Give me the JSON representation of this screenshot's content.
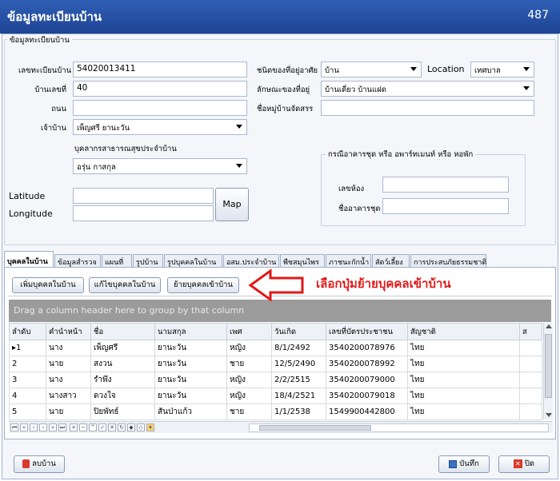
{
  "window": {
    "title": "ข้อมูลทะเบียนบ้าน",
    "record_id": "487"
  },
  "group_title": "ข้อมูลทะเบียนบ้าน",
  "form": {
    "house_reg_label": "เลขทะเบียนบ้าน",
    "house_reg_value": "54020013411",
    "house_no_label": "บ้านเลขที่",
    "house_no_value": "40",
    "road_label": "ถนน",
    "road_value": "",
    "owner_label": "เจ้าบ้าน",
    "owner_value": "เพ็ญศรี ยานะวัน",
    "health_staff_label": "บุคลากรสาธารณสุขประจำบ้าน",
    "health_staff_value": "อรุ่น กาสกุล",
    "latitude_label": "Latitude",
    "latitude_value": "",
    "longitude_label": "Longitude",
    "longitude_value": "",
    "map_button": "Map",
    "residence_type_label": "ชนิดของที่อยู่อาศัย",
    "residence_type_value": "บ้าน",
    "location_label": "Location",
    "location_value": "เทศบาล",
    "residence_style_label": "ลักษณะของที่อยู่",
    "residence_style_value": "บ้านเดี่ยว บ้านแฝด",
    "village_project_label": "ชื่อหมู่บ้านจัดสรร",
    "village_project_value": ""
  },
  "condo": {
    "title": "กรณีอาคารชุด หรือ อพาร์ทเมนท์ หรือ หอพัก",
    "room_label": "เลขห้อง",
    "room_value": "",
    "building_label": "ชื่ออาคารชุด",
    "building_value": ""
  },
  "tabs": [
    "บุคคลในบ้าน",
    "ข้อมูลสำรวจ",
    "แผนที่",
    "รูปบ้าน",
    "รูปบุคคลในบ้าน",
    "อสม.ประจำบ้าน",
    "พืชสมุนไพร",
    "ภาชนะกักน้ำ",
    "สัตว์เลี้ยง",
    "การประสบภัยธรรมชาติ"
  ],
  "toolbar": {
    "add_person": "เพิ่มบุคคลในบ้าน",
    "edit_person": "แก้ไขบุคคลในบ้าน",
    "move_person": "ย้ายบุคคลเข้าบ้าน"
  },
  "annotation": "เลือกปุ่มย้ายบุคคลเข้าบ้าน",
  "grid": {
    "group_hint": "Drag a column header here to group by that column",
    "columns": [
      "ลำดับ",
      "คำนำหน้า",
      "ชื่อ",
      "นามสกุล",
      "เพศ",
      "วันเกิด",
      "เลขที่บัตรประชาชน",
      "สัญชาติ",
      "ส"
    ],
    "rows": [
      [
        "1",
        "นาง",
        "เพ็ญศรี",
        "ยานะวัน",
        "หญิง",
        "8/1/2492",
        "3540200078976",
        "ไทย",
        ""
      ],
      [
        "2",
        "นาย",
        "สงวน",
        "ยานะวัน",
        "ชาย",
        "12/5/2490",
        "3540200078992",
        "ไทย",
        ""
      ],
      [
        "3",
        "นาง",
        "รำพึง",
        "ยานะวัน",
        "หญิง",
        "2/2/2515",
        "3540200079000",
        "ไทย",
        ""
      ],
      [
        "4",
        "นางสาว",
        "ดวงใจ",
        "ยานะวัน",
        "หญิง",
        "18/4/2521",
        "3540200079018",
        "ไทย",
        ""
      ],
      [
        "5",
        "นาย",
        "ปิยพัทธ์",
        "สันป่าแก้ว",
        "ชาย",
        "1/1/2538",
        "1549900442800",
        "ไทย",
        ""
      ]
    ]
  },
  "footer": {
    "delete_house": "ลบบ้าน",
    "save": "บันทึก",
    "close": "ปิด"
  }
}
